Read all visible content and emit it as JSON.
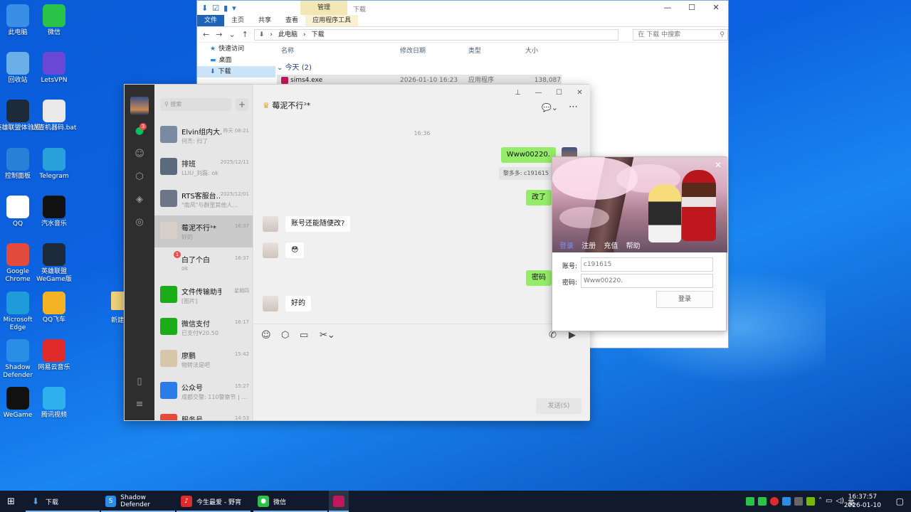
{
  "desktop": {
    "icons": [
      {
        "label": "此电脑",
        "color": "#3a8ee6"
      },
      {
        "label": "微信",
        "color": "#2bc24a"
      },
      {
        "label": "回收站",
        "color": "#6aaee8"
      },
      {
        "label": "LetsVPN",
        "color": "#6b47d6"
      },
      {
        "label": "英雄联盟体验服",
        "color": "#1c2a3a"
      },
      {
        "label": "LY查机器码.bat",
        "color": "#e9e9e9"
      },
      {
        "label": "控制面板",
        "color": "#2a7fd6"
      },
      {
        "label": "Telegram",
        "color": "#2aa1db"
      },
      {
        "label": "QQ",
        "color": "#ffffff"
      },
      {
        "label": "汽水音乐",
        "color": "#111111"
      },
      {
        "label": "Google Chrome",
        "color": "#e24a3b"
      },
      {
        "label": "英雄联盟WeGame版",
        "color": "#1c2a3a"
      },
      {
        "label": "Microsoft Edge",
        "color": "#1f9bd9"
      },
      {
        "label": "QQ飞车",
        "color": "#f4b325"
      },
      {
        "label": "Shadow Defender",
        "color": "#2a8ee6"
      },
      {
        "label": "网易云音乐",
        "color": "#e12b2b"
      },
      {
        "label": "WeGame",
        "color": "#111111"
      },
      {
        "label": "腾讯视频",
        "color": "#2fb1f0"
      }
    ],
    "partial_label": "新建"
  },
  "explorer": {
    "context_tab": "管理",
    "window_name": "下载",
    "ribbon_tabs": [
      "文件",
      "主页",
      "共享",
      "查看",
      "应用程序工具"
    ],
    "path": [
      "此电脑",
      "下载"
    ],
    "search_placeholder": "在 下载 中搜索",
    "nav": [
      "快速访问",
      "桌面",
      "下载"
    ],
    "columns": [
      "名称",
      "修改日期",
      "类型",
      "大小"
    ],
    "group": "今天 (2)",
    "file": {
      "name": "sims4.exe",
      "date": "2026-01-10 16:23",
      "type": "应用程序",
      "size": "138,087 KB"
    }
  },
  "wechat": {
    "search_placeholder": "搜索",
    "side_badge": "3",
    "conversations": [
      {
        "name": "Elvin组内大...",
        "time": "昨天 08:21",
        "preview": "何杰: 扫了",
        "color": "#7a8aa0"
      },
      {
        "name": "排班",
        "time": "2025/12/11",
        "preview": "LLIU_刘磊: ok",
        "color": "#5c6a7e"
      },
      {
        "name": "RTS客服台...",
        "time": "2025/12/01",
        "preview": "\"南风\"与群里其他人...",
        "color": "#6c7688"
      },
      {
        "name": "莓泥不行ᐣ*",
        "time": "16:37",
        "preview": "好的",
        "color": "#d8cfc9"
      },
      {
        "name": "白了个白",
        "time": "16:37",
        "preview": "ok",
        "color": "#e6e6e6",
        "badge": "1"
      },
      {
        "name": "文件传输助手",
        "time": "星期四",
        "preview": "[图片]",
        "color": "#1aad19"
      },
      {
        "name": "微信支付",
        "time": "16:17",
        "preview": "已支付¥20.50",
        "color": "#1aad19"
      },
      {
        "name": "廖鹏",
        "time": "15:42",
        "preview": "物转法是吧",
        "color": "#d8c6a8"
      },
      {
        "name": "公众号",
        "time": "15:27",
        "preview": "成都交警: 110警察节 | ...",
        "color": "#2b7ce9"
      },
      {
        "name": "服务号",
        "time": "14:53",
        "preview": "",
        "color": "#e64a3b"
      }
    ],
    "chat_title": "莓泥不行ᐣ*",
    "time_divider": "16:36",
    "messages": {
      "m1": "Www00220.",
      "quote": "黎多多: c191615",
      "m2": "改了",
      "m3": "账号还能随便改?",
      "m4": "😳",
      "m5": "密码",
      "m6": "好的"
    },
    "send_label": "发送(S)"
  },
  "login": {
    "tabs": [
      "登录",
      "注册",
      "充值",
      "帮助"
    ],
    "account_label": "账号:",
    "account_value": "c191615",
    "password_label": "密码:",
    "password_value": "Www00220.",
    "login_button": "登录"
  },
  "taskbar": {
    "items": [
      "下载",
      "Shadow Defender",
      "今生最爱 - 野宵",
      "微信"
    ],
    "ime": "英",
    "time": "16:37:57",
    "date": "2026-01-10"
  }
}
